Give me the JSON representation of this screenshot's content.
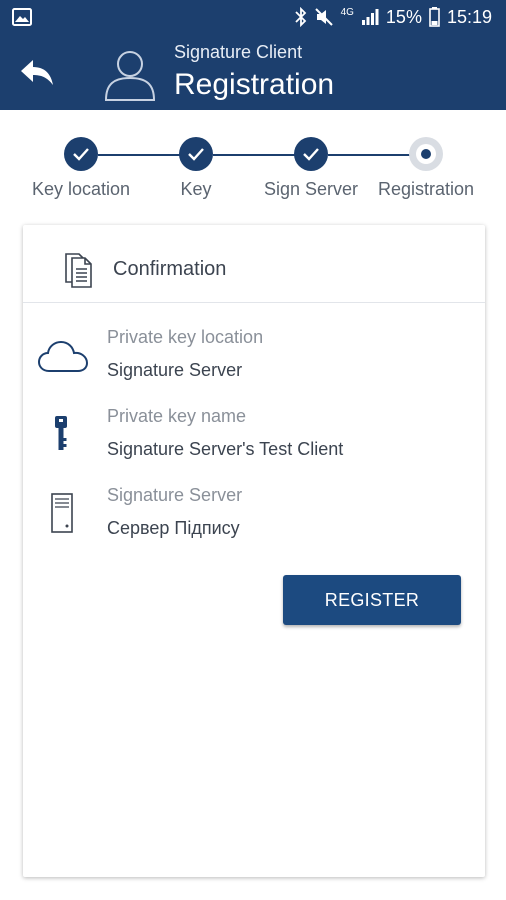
{
  "status_bar": {
    "battery": "15%",
    "time": "15:19",
    "network": "4G"
  },
  "app_bar": {
    "subtitle": "Signature Client",
    "title": "Registration"
  },
  "stepper": {
    "steps": [
      {
        "label": "Key location",
        "state": "done"
      },
      {
        "label": "Key",
        "state": "done"
      },
      {
        "label": "Sign Server",
        "state": "done"
      },
      {
        "label": "Registration",
        "state": "current"
      }
    ]
  },
  "card": {
    "title": "Confirmation",
    "rows": [
      {
        "icon": "cloud-icon",
        "label": "Private key location",
        "value": "Signature Server"
      },
      {
        "icon": "key-icon",
        "label": "Private key name",
        "value": "Signature Server's Test Client"
      },
      {
        "icon": "server-icon",
        "label": "Signature Server",
        "value": "Сервер Підпису"
      }
    ],
    "register_label": "REGISTER"
  },
  "colors": {
    "primary": "#1c3f6e",
    "button": "#1c4a80"
  }
}
